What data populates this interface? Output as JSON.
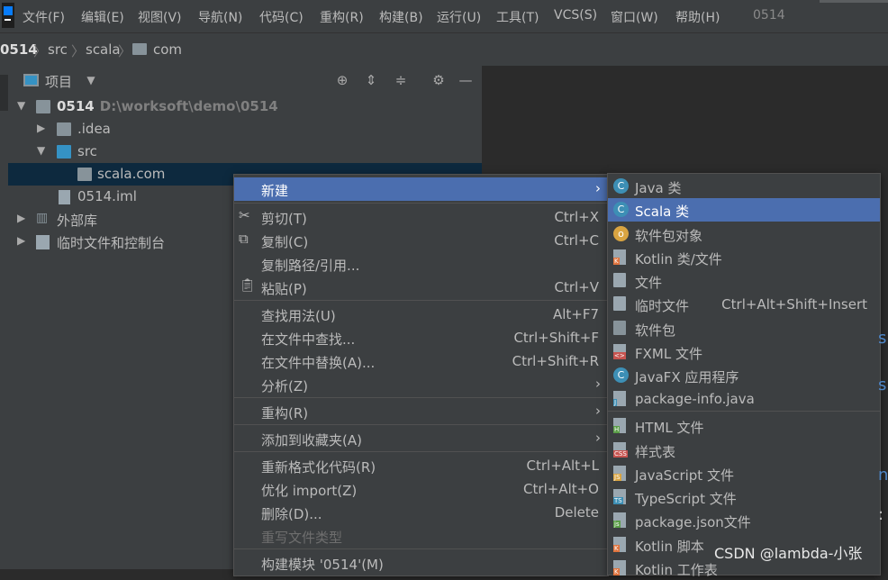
{
  "menubar": {
    "items": [
      "文件(F)",
      "编辑(E)",
      "视图(V)",
      "导航(N)",
      "代码(C)",
      "重构(R)",
      "构建(B)",
      "运行(U)",
      "工具(T)",
      "VCS(S)",
      "窗口(W)",
      "帮助(H)"
    ],
    "project_name": "0514"
  },
  "breadcrumb": {
    "items": [
      "0514",
      "src",
      "scala",
      "com"
    ]
  },
  "panel": {
    "title": "项目",
    "tree": [
      {
        "label": "0514",
        "sub": "D:\\worksoft\\demo\\0514",
        "icon": "module-folder-icon"
      },
      {
        "label": ".idea",
        "icon": "folder-icon"
      },
      {
        "label": "src",
        "icon": "source-folder-icon"
      },
      {
        "label": "scala.com",
        "icon": "package-icon"
      },
      {
        "label": "0514.iml",
        "icon": "iml-file-icon"
      },
      {
        "label": "外部库",
        "icon": "libraries-icon"
      },
      {
        "label": "临时文件和控制台",
        "icon": "scratches-icon"
      }
    ]
  },
  "context_menu": {
    "items": [
      {
        "label": "新建",
        "shortcut": ""
      },
      {
        "label": "剪切(T)",
        "shortcut": "Ctrl+X"
      },
      {
        "label": "复制(C)",
        "shortcut": "Ctrl+C"
      },
      {
        "label": "复制路径/引用...",
        "shortcut": ""
      },
      {
        "label": "粘贴(P)",
        "shortcut": "Ctrl+V"
      },
      {
        "label": "查找用法(U)",
        "shortcut": "Alt+F7"
      },
      {
        "label": "在文件中查找...",
        "shortcut": "Ctrl+Shift+F"
      },
      {
        "label": "在文件中替换(A)...",
        "shortcut": "Ctrl+Shift+R"
      },
      {
        "label": "分析(Z)",
        "shortcut": ""
      },
      {
        "label": "重构(R)",
        "shortcut": ""
      },
      {
        "label": "添加到收藏夹(A)",
        "shortcut": ""
      },
      {
        "label": "重新格式化代码(R)",
        "shortcut": "Ctrl+Alt+L"
      },
      {
        "label": "优化 import(Z)",
        "shortcut": "Ctrl+Alt+O"
      },
      {
        "label": "删除(D)...",
        "shortcut": "Delete"
      },
      {
        "label": "重写文件类型",
        "shortcut": ""
      },
      {
        "label": "构建模块 '0514'(M)",
        "shortcut": ""
      }
    ]
  },
  "submenu": {
    "items": [
      {
        "label": "Java 类",
        "shortcut": "",
        "icon": "java-class-icon",
        "color": "#3d8fb5",
        "glyph": "C"
      },
      {
        "label": "Scala 类",
        "shortcut": "",
        "icon": "scala-class-icon",
        "color": "#3d8fb5",
        "glyph": "C"
      },
      {
        "label": "软件包对象",
        "shortcut": "",
        "icon": "package-object-icon",
        "color": "#d9a441",
        "glyph": "o"
      },
      {
        "label": "Kotlin 类/文件",
        "shortcut": "",
        "icon": "kotlin-file-icon",
        "color": "#e0743e",
        "glyph": "K"
      },
      {
        "label": "文件",
        "shortcut": "",
        "icon": "file-icon",
        "color": "#9aa7b0",
        "glyph": ""
      },
      {
        "label": "临时文件",
        "shortcut": "Ctrl+Alt+Shift+Insert",
        "icon": "scratch-file-icon",
        "color": "#9aa7b0",
        "glyph": ""
      },
      {
        "label": "软件包",
        "shortcut": "",
        "icon": "package-folder-icon",
        "color": "#87939a",
        "glyph": ""
      },
      {
        "label": "FXML 文件",
        "shortcut": "",
        "icon": "fxml-file-icon",
        "color": "#c75450",
        "glyph": "<>"
      },
      {
        "label": "JavaFX 应用程序",
        "shortcut": "",
        "icon": "javafx-icon",
        "color": "#3d8fb5",
        "glyph": "C"
      },
      {
        "label": "package-info.java",
        "shortcut": "",
        "icon": "package-info-icon",
        "color": "#3d8fb5",
        "glyph": "J"
      },
      {
        "label": "HTML 文件",
        "shortcut": "",
        "icon": "html-file-icon",
        "color": "#5a9e47",
        "glyph": "H"
      },
      {
        "label": "样式表",
        "shortcut": "",
        "icon": "css-file-icon",
        "color": "#c75450",
        "glyph": "CSS"
      },
      {
        "label": "JavaScript 文件",
        "shortcut": "",
        "icon": "javascript-file-icon",
        "color": "#d9a441",
        "glyph": "JS"
      },
      {
        "label": "TypeScript 文件",
        "shortcut": "",
        "icon": "typescript-file-icon",
        "color": "#3d8fb5",
        "glyph": "TS"
      },
      {
        "label": "package.json文件",
        "shortcut": "",
        "icon": "nodejs-icon",
        "color": "#5a9e47",
        "glyph": "js"
      },
      {
        "label": "Kotlin 脚本",
        "shortcut": "",
        "icon": "kotlin-script-icon",
        "color": "#e0743e",
        "glyph": "K"
      },
      {
        "label": "Kotlin 工作表",
        "shortcut": "",
        "icon": "kotlin-worksheet-icon",
        "color": "#e0743e",
        "glyph": "K"
      }
    ]
  },
  "watermark": "CSDN @lambda-小张",
  "colors": {
    "selection": "#4b6eaf",
    "panel": "#3c3f41",
    "editor": "#2b2b2b",
    "tree_selection": "#0d293e"
  }
}
